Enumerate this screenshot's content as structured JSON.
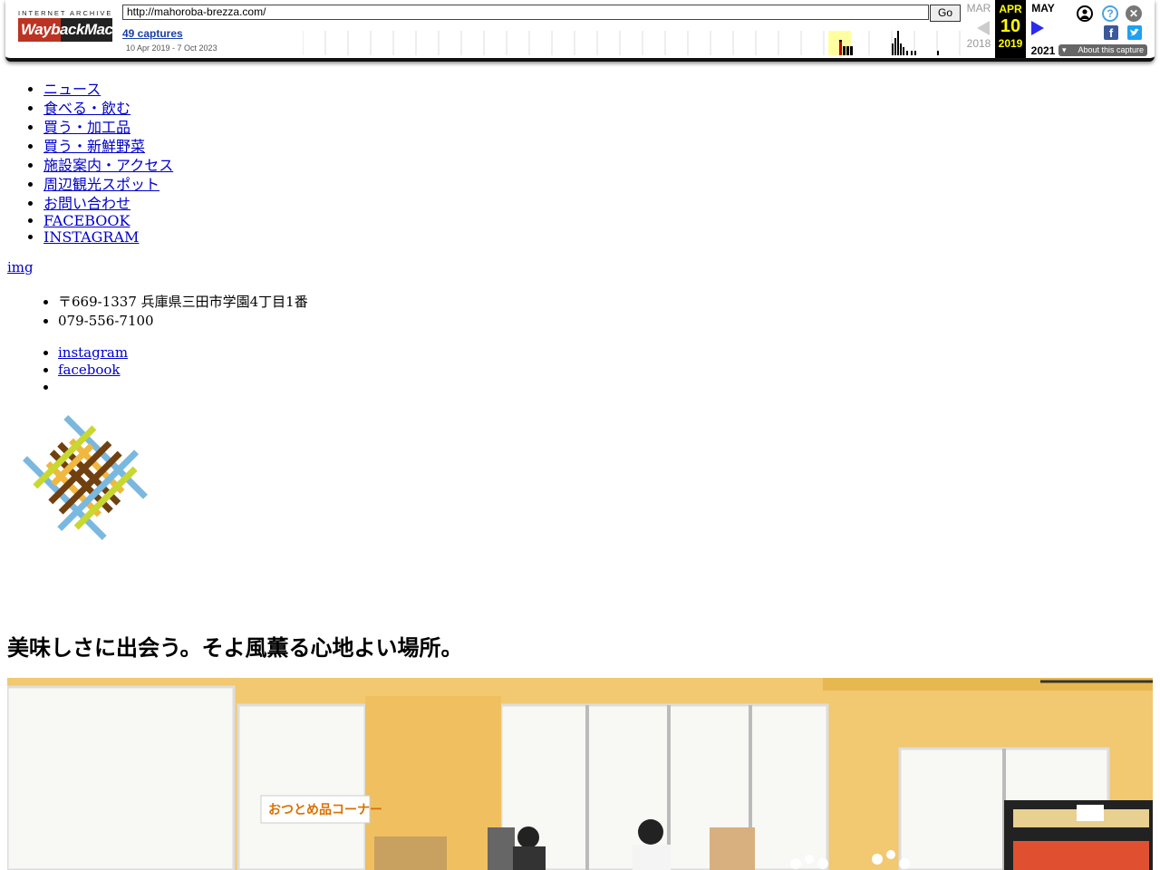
{
  "wayback": {
    "logo_top": "INTERNET ARCHIVE",
    "logo_main": "WaybackMachine",
    "url": "http://mahoroba-brezza.com/",
    "go_label": "Go",
    "captures_label": "49 captures",
    "date_range": "10 Apr 2019 - 7 Oct 2023",
    "prev_month": "MAR",
    "prev_year": "2018",
    "current_month": "APR",
    "current_day": "10",
    "current_year": "2019",
    "next_month": "MAY",
    "next_year": "2021",
    "about_label": "About this capture",
    "accent_color": "#ffff00"
  },
  "nav": {
    "items": [
      "ニュース",
      "食べる・飲む",
      "買う・加工品",
      "買う・新鮮野菜",
      "施設案内・アクセス",
      "周辺観光スポット",
      "お問い合わせ",
      "FACEBOOK",
      "INSTAGRAM"
    ]
  },
  "header_img_alt": "img",
  "contact": {
    "address": "〒669-1337 兵庫県三田市学園4丁目1番",
    "phone": "079-556-7100"
  },
  "social": {
    "instagram": "instagram",
    "facebook": "facebook"
  },
  "tagline": "美味しさに出会う。そよ風薫る心地よい場所。",
  "hero": {
    "sign_text": "おつとめ品コーナー"
  },
  "brand_colors": [
    "#7ab8e0",
    "#f0b840",
    "#704010",
    "#c8d830"
  ]
}
